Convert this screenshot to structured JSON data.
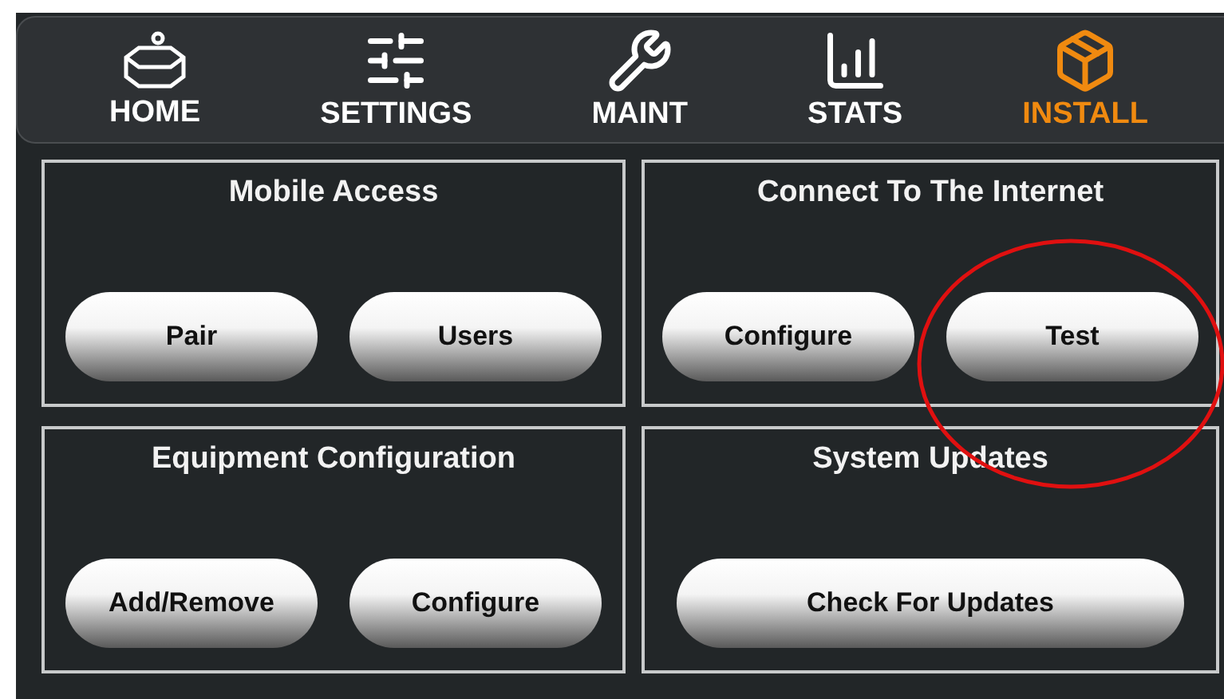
{
  "nav": [
    {
      "label": "HOME",
      "selected": false
    },
    {
      "label": "SETTINGS",
      "selected": false
    },
    {
      "label": "MAINT",
      "selected": false
    },
    {
      "label": "STATS",
      "selected": false
    },
    {
      "label": "INSTALL",
      "selected": true
    }
  ],
  "panels": [
    {
      "title": "Mobile Access",
      "buttons": [
        "Pair",
        "Users"
      ]
    },
    {
      "title": "Connect To The Internet",
      "buttons": [
        "Configure",
        "Test"
      ]
    },
    {
      "title": "Equipment Configuration",
      "buttons": [
        "Add/Remove",
        "Configure"
      ]
    },
    {
      "title": "System Updates",
      "buttons": [
        "Check For Updates"
      ]
    }
  ],
  "annotation": {
    "kind": "circle",
    "color": "#e01010"
  }
}
